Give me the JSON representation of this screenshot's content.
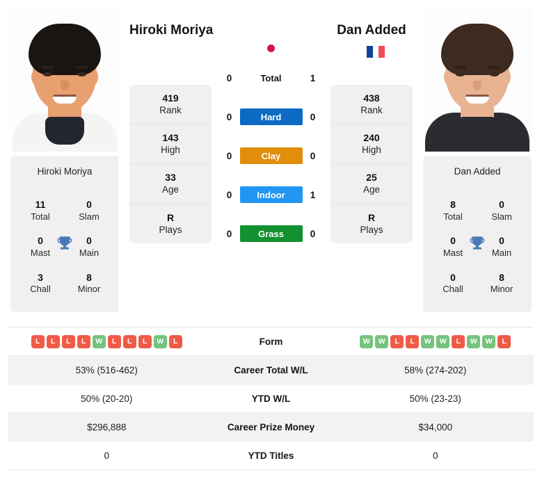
{
  "players": {
    "left": {
      "name": "Hiroki Moriya",
      "card_name": "Hiroki Moriya",
      "flag": "japan-flag",
      "rank": "419",
      "rank_label": "Rank",
      "high": "143",
      "high_label": "High",
      "age": "33",
      "age_label": "Age",
      "plays": "R",
      "plays_label": "Plays",
      "titles": {
        "total": "11",
        "total_label": "Total",
        "slam": "0",
        "slam_label": "Slam",
        "mast": "0",
        "mast_label": "Mast",
        "main": "0",
        "main_label": "Main",
        "chall": "3",
        "chall_label": "Chall",
        "minor": "8",
        "minor_label": "Minor"
      },
      "form": [
        "L",
        "L",
        "L",
        "L",
        "W",
        "L",
        "L",
        "L",
        "W",
        "L"
      ],
      "career_wl": "53% (516-462)",
      "ytd_wl": "50% (20-20)",
      "prize_money": "$296,888",
      "ytd_titles": "0"
    },
    "right": {
      "name": "Dan Added",
      "card_name": "Dan Added",
      "flag": "france-flag",
      "rank": "438",
      "rank_label": "Rank",
      "high": "240",
      "high_label": "High",
      "age": "25",
      "age_label": "Age",
      "plays": "R",
      "plays_label": "Plays",
      "titles": {
        "total": "8",
        "total_label": "Total",
        "slam": "0",
        "slam_label": "Slam",
        "mast": "0",
        "mast_label": "Mast",
        "main": "0",
        "main_label": "Main",
        "chall": "0",
        "chall_label": "Chall",
        "minor": "8",
        "minor_label": "Minor"
      },
      "form": [
        "W",
        "W",
        "L",
        "L",
        "W",
        "W",
        "L",
        "W",
        "W",
        "L"
      ],
      "career_wl": "58% (274-202)",
      "ytd_wl": "50% (23-23)",
      "prize_money": "$34,000",
      "ytd_titles": "0"
    }
  },
  "h2h": [
    {
      "label": "Total",
      "left": "0",
      "right": "1",
      "color": ""
    },
    {
      "label": "Hard",
      "left": "0",
      "right": "0",
      "color": "#0b6bc4"
    },
    {
      "label": "Clay",
      "left": "0",
      "right": "0",
      "color": "#e08e0b"
    },
    {
      "label": "Indoor",
      "left": "0",
      "right": "1",
      "color": "#2196f3"
    },
    {
      "label": "Grass",
      "left": "0",
      "right": "0",
      "color": "#119130"
    }
  ],
  "table": {
    "rows": [
      {
        "label": "Form"
      },
      {
        "label": "Career Total W/L"
      },
      {
        "label": "YTD W/L"
      },
      {
        "label": "Career Prize Money"
      },
      {
        "label": "YTD Titles"
      }
    ]
  },
  "colors": {
    "hard": "#0b6bc4",
    "clay": "#e08e0b",
    "indoor": "#2196f3",
    "grass": "#119130",
    "win": "#75c37e",
    "loss": "#ef5b47",
    "card_bg": "#f0f0f0",
    "trophy": "#4a7ab5"
  }
}
